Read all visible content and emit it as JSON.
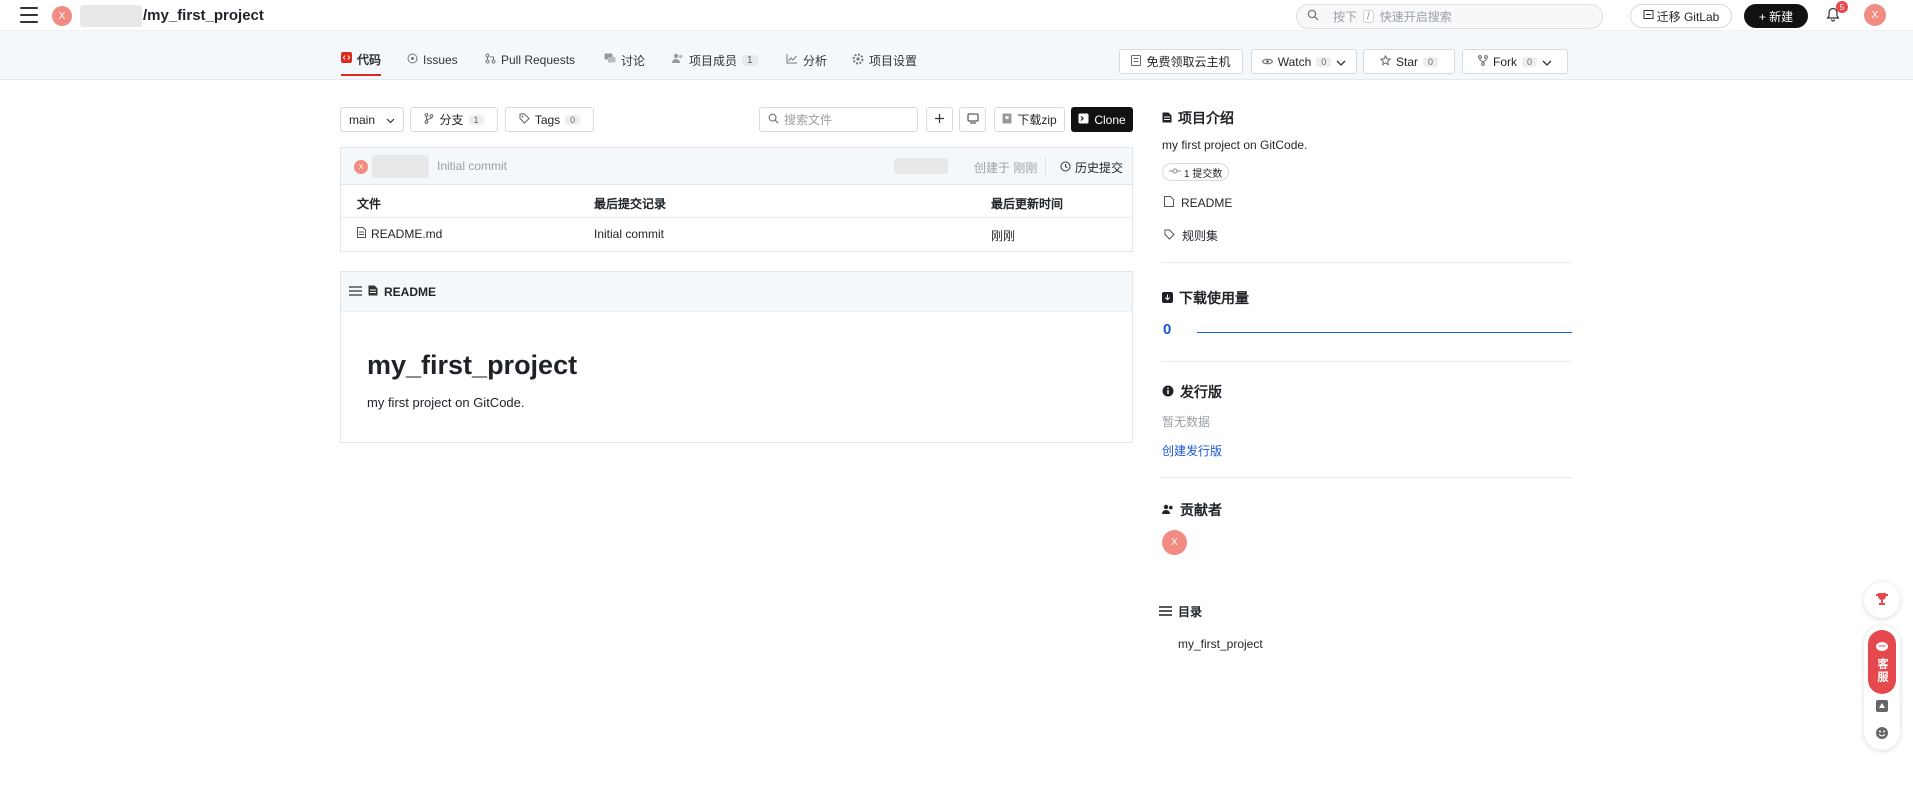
{
  "header": {
    "project_name": "/my_first_project",
    "avatar_letter": "X",
    "search_prefix": "按下",
    "search_key": "/",
    "search_placeholder": "快速开启搜索",
    "migrate_label": "迁移 GitLab",
    "new_label": "+ 新建",
    "notifications_count": "5"
  },
  "tabs": [
    {
      "label": "代码",
      "count": null
    },
    {
      "label": "Issues",
      "count": null
    },
    {
      "label": "Pull Requests",
      "count": null
    },
    {
      "label": "讨论",
      "count": null
    },
    {
      "label": "项目成员",
      "count": "1"
    },
    {
      "label": "分析",
      "count": null
    },
    {
      "label": "项目设置",
      "count": null
    }
  ],
  "actions": {
    "cloud_label": "免费领取云主机",
    "watch_label": "Watch",
    "watch_count": "0",
    "star_label": "Star",
    "star_count": "0",
    "fork_label": "Fork",
    "fork_count": "0"
  },
  "toolbar": {
    "branch": "main",
    "branches_label": "分支",
    "branches_count": "1",
    "tags_label": "Tags",
    "tags_count": "0",
    "search_files_placeholder": "搜索文件",
    "download_label": "下载zip",
    "clone_label": "Clone"
  },
  "commit": {
    "message": "Initial commit",
    "created_label": "创建于 刚刚",
    "history_label": "历史提交"
  },
  "files": {
    "headers": [
      "文件",
      "最后提交记录",
      "最后更新时间"
    ],
    "rows": [
      {
        "name": "README.md",
        "commit": "Initial commit",
        "time": "刚刚"
      }
    ]
  },
  "readme": {
    "header": "README",
    "title": "my_first_project",
    "body": "my first project on GitCode."
  },
  "sidebar": {
    "intro_title": "项目介绍",
    "intro_desc": "my first project on GitCode.",
    "commits_badge": "1 提交数",
    "readme_link": "README",
    "rules_link": "规则集",
    "downloads_title": "下载使用量",
    "downloads_value": "0",
    "releases_title": "发行版",
    "releases_empty": "暂无数据",
    "create_release": "创建发行版",
    "contributors_title": "贡献者",
    "toc_title": "目录",
    "toc_item": "my_first_project"
  },
  "float": {
    "service_label": "客服"
  },
  "colors": {
    "accent_red": "#d92d20",
    "avatar": "#f28b82",
    "link_blue": "#1a56db"
  }
}
